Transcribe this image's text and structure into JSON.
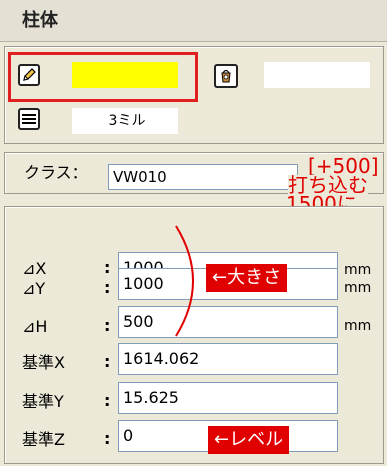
{
  "title": "柱体",
  "attributes": {
    "line_weight_value": "3ミル",
    "fill_color": "#ffff00",
    "pen_color": "#ffffff"
  },
  "class_row": {
    "label": "クラス：",
    "value": "VW010"
  },
  "annotation": {
    "line1": "[+500]",
    "line2": "打ち込む",
    "line3": "1500に"
  },
  "dimensions": {
    "dx_label": "⊿X",
    "dx_colon": ":",
    "dx_value": "1000",
    "dx_unit": "mm",
    "dy_label": "⊿Y",
    "dy_colon": ":",
    "dy_value": "1000",
    "dy_unit": "mm",
    "dh_label": "⊿H",
    "dh_colon": ":",
    "dh_value": "500",
    "dh_unit": "mm",
    "bx_label": "基準X",
    "bx_colon": ":",
    "bx_value": "1614.062",
    "by_label": "基準Y",
    "by_colon": ":",
    "by_value": "15.625",
    "bz_label": "基準Z",
    "bz_colon": ":",
    "bz_value": "0"
  },
  "callouts": {
    "size": "←大きさ",
    "level": "←レベル"
  }
}
